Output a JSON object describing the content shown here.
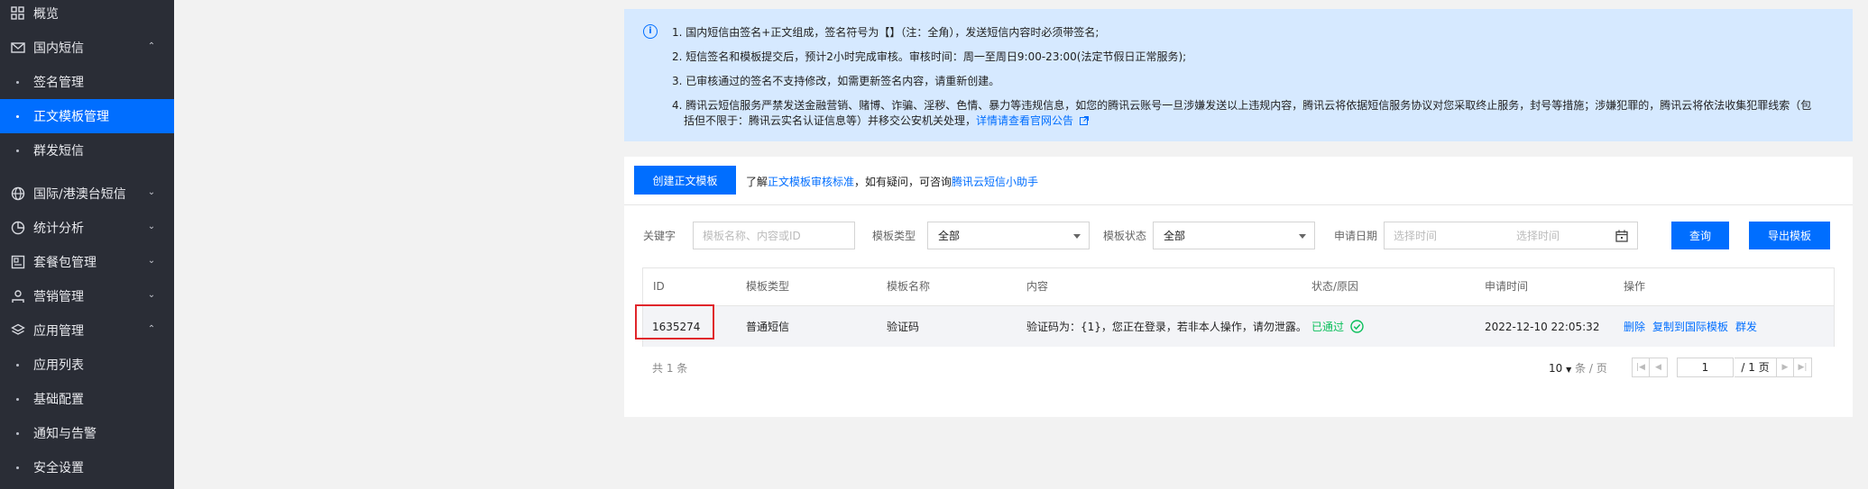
{
  "sidebar": {
    "items": [
      {
        "label": "概览",
        "icon": "grid-icon"
      },
      {
        "label": "国内短信",
        "icon": "mail-icon",
        "chevron": "⌃"
      },
      {
        "label": "签名管理"
      },
      {
        "label": "正文模板管理"
      },
      {
        "label": "群发短信"
      },
      {
        "label": "国际/港澳台短信",
        "icon": "globe-icon",
        "chevron": "⌄"
      },
      {
        "label": "统计分析",
        "icon": "pie-chart-icon",
        "chevron": "⌄"
      },
      {
        "label": "套餐包管理",
        "icon": "package-icon",
        "chevron": "⌄"
      },
      {
        "label": "营销管理",
        "icon": "user-icon",
        "chevron": "⌄"
      },
      {
        "label": "应用管理",
        "icon": "layers-icon",
        "chevron": "⌃"
      },
      {
        "label": "应用列表"
      },
      {
        "label": "基础配置"
      },
      {
        "label": "通知与告警"
      },
      {
        "label": "安全设置"
      }
    ]
  },
  "notice": {
    "line1": "1. 国内短信由签名+正文组成，签名符号为【】（注：全角），发送短信内容时必须带签名;",
    "line2": "2. 短信签名和模板提交后，预计2小时完成审核。审核时间：周一至周日9:00-23:00(法定节假日正常服务);",
    "line3": "3. 已审核通过的签名不支持修改，如需更新签名内容，请重新创建。",
    "line4a": "4. 腾讯云短信服务严禁发送金融营销、赌博、诈骗、淫秽、色情、暴力等违规信息，如您的腾讯云账号一旦涉嫌发送以上违规内容，腾讯云将依据短信服务协议对您采取终止服务，封号等措施；涉嫌犯罪的，腾讯云将依法收集犯罪线索（包",
    "line4b": "括但不限于：腾讯云实名认证信息等）并移交公安机关处理，",
    "line4_link": "详情请查看官网公告"
  },
  "toolbar": {
    "create_button": "创建正文模板",
    "hint_prefix": "了解",
    "hint_link1": "正文模板审核标准",
    "hint_mid": "，如有疑问，可咨询",
    "hint_link2": "腾讯云短信小助手"
  },
  "filters": {
    "keyword_label": "关键字",
    "keyword_placeholder": "模板名称、内容或ID",
    "type_label": "模板类型",
    "type_value": "全部",
    "status_label": "模板状态",
    "status_value": "全部",
    "date_label": "申请日期",
    "date_start_placeholder": "选择时间",
    "date_end_placeholder": "选择时间",
    "query_button": "查询",
    "export_button": "导出模板"
  },
  "table": {
    "headers": [
      "ID",
      "模板类型",
      "模板名称",
      "内容",
      "状态/原因",
      "申请时间",
      "操作"
    ],
    "rows": [
      {
        "id": "1635274",
        "type": "普通短信",
        "name": "验证码",
        "content": "验证码为：{1}，您正在登录，若非本人操作，请勿泄露。",
        "status": "已通过",
        "time": "2022-12-10 22:05:32",
        "actions": [
          "删除",
          "复制到国际模板",
          "群发"
        ]
      }
    ]
  },
  "pagination": {
    "total": "共 1 条",
    "page_size": "10",
    "page_size_suffix": "条 / 页",
    "current_page": "1",
    "total_pages": "/ 1 页"
  },
  "colors": {
    "accent": "#006eff",
    "sidebar_bg": "#2a2d36",
    "success": "#0abf5b",
    "highlight": "#e0262b"
  }
}
